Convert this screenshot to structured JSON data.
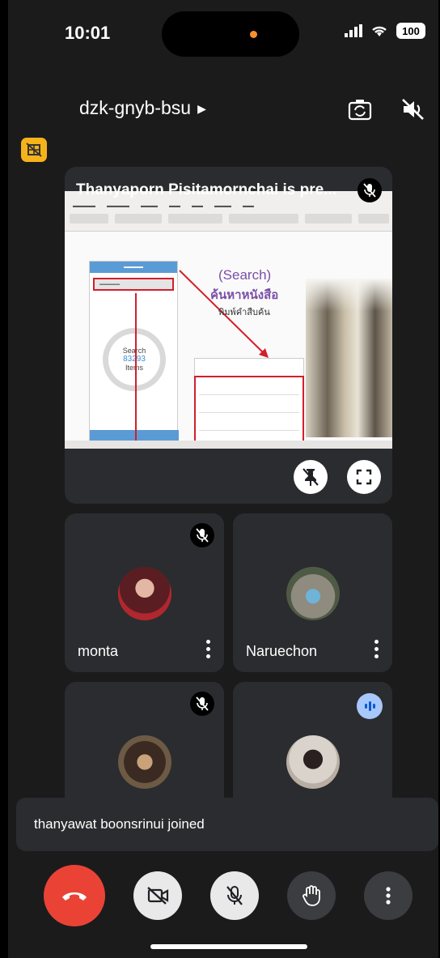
{
  "status_bar": {
    "time": "10:01",
    "battery": "100"
  },
  "header": {
    "meeting_code": "dzk-gnyb-bsu"
  },
  "presentation": {
    "title": "Thanyaporn Pisitamornchai is pre...",
    "slide": {
      "heading_en": "(Search)",
      "heading_th": "ค้นหาหนังสือ",
      "subheading_th": "พิมพ์คำสืบค้น",
      "phone_label": "Search",
      "phone_count": "83293",
      "phone_unit": "Items"
    }
  },
  "participants": [
    {
      "name": "monta",
      "muted": true
    },
    {
      "name": "Naruechon",
      "muted": false
    },
    {
      "name": "",
      "muted": true
    },
    {
      "name": "",
      "speaking": true
    }
  ],
  "toast": {
    "message": "thanyawat boonsrinui joined"
  },
  "icons": {
    "hangup": "hangup-icon",
    "camera": "camera-off-icon",
    "mic": "mic-off-icon",
    "hand": "raise-hand-icon",
    "more": "more-vert-icon"
  },
  "colors": {
    "end_call": "#ea4335",
    "badge": "#f6b21b",
    "speaking": "#a8c7fa"
  }
}
